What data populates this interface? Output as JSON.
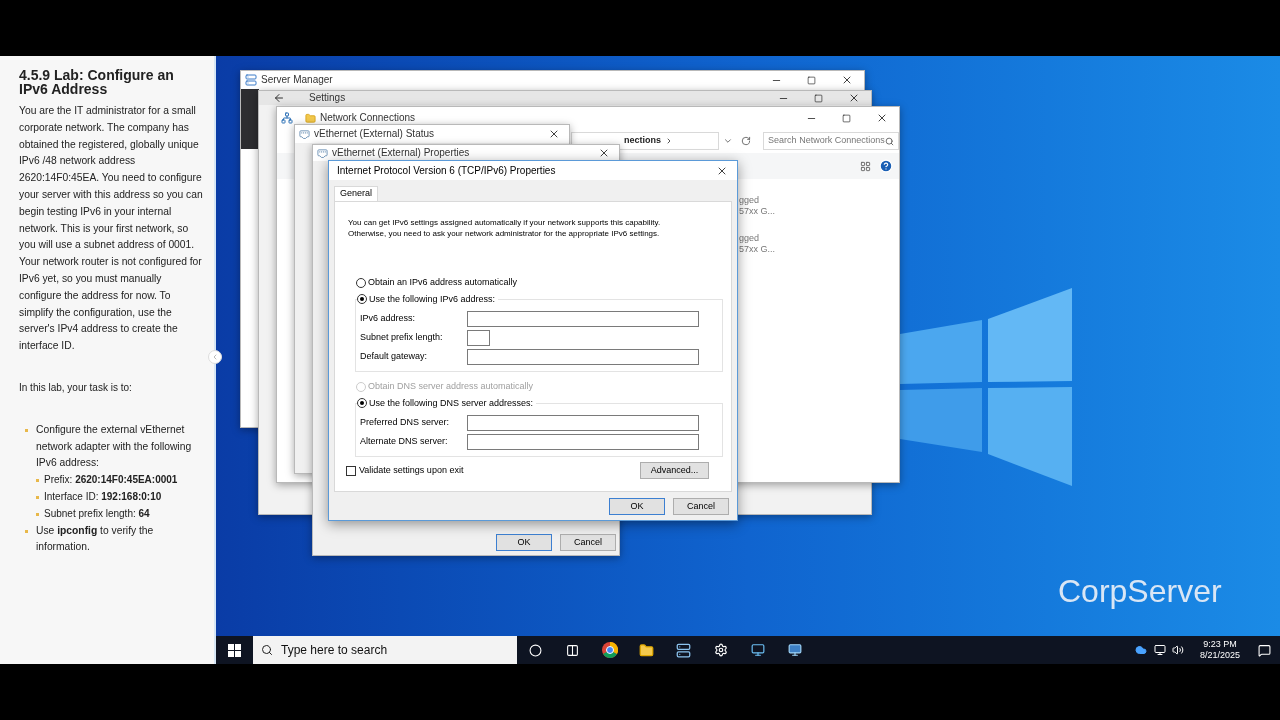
{
  "lesson": {
    "title": "4.5.9 Lab: Configure an IPv6 Address",
    "paragraph": "You are the IT administrator for a small corporate network. The company has obtained the registered, globally unique IPv6 /48 network address 2620:14F0:45EA. You need to configure your server with this address so you can begin testing IPv6 in your internal network. This is your first network, so you will use a subnet address of 0001. Your network router is not configured for IPv6 yet, so you must manually configure the address for now. To simplify the configuration, use the server's IPv4 address to create the interface ID.",
    "task_intro": "In this lab, your task is to:",
    "tasks": [
      {
        "text": "Configure the external vEthernet network adapter with the following IPv6 address:",
        "children": [
          {
            "text": "Prefix: **2620:14F0:45EA:0001**"
          },
          {
            "text": "Interface ID: **192:168:0:10**"
          },
          {
            "text": "Subnet prefix length: **64**"
          }
        ]
      },
      {
        "text": "Use **ipconfig** to verify the information."
      }
    ]
  },
  "windows": [
    {
      "kind": "server-manager",
      "title": "Server Manager",
      "minimizable": true
    },
    {
      "kind": "settings",
      "title": "Settings",
      "minimizable": true
    },
    {
      "kind": "network-connections",
      "title": "Network Connections",
      "minimizable": true,
      "address": "nections",
      "search": {
        "placeholder": "Search Network Connections"
      },
      "items": [
        {
          "status": "gged",
          "device": "57xx G..."
        },
        {
          "status": "gged",
          "device": "57xx G..."
        }
      ]
    },
    {
      "kind": "status",
      "title": "vEthernet (External) Status",
      "minimizable": false
    },
    {
      "kind": "properties",
      "title": "vEthernet (External) Properties",
      "minimizable": false,
      "buttons": [
        {
          "label": "OK",
          "default": true
        },
        {
          "label": "Cancel",
          "default": false
        }
      ]
    }
  ],
  "dialog": {
    "title": "Internet Protocol Version 6 (TCP/IPv6) Properties",
    "tabs": [
      {
        "label": "General",
        "selected": true
      }
    ],
    "intro": [
      "You can get IPv6 settings assigned automatically if your network supports this capability.",
      "Otherwise, you need to ask your network administrator for the appropriate IPv6 settings."
    ],
    "address_options": [
      {
        "label": "Obtain an IPv6 address automatically",
        "selected": false,
        "disabled": false
      },
      {
        "label": "Use the following IPv6 address:",
        "selected": true,
        "disabled": false
      }
    ],
    "address_fields": [
      {
        "label": "IPv6 address:",
        "kind": "wide"
      },
      {
        "label": "Subnet prefix length:",
        "kind": "short"
      },
      {
        "label": "Default gateway:",
        "kind": "wide"
      }
    ],
    "dns_options": [
      {
        "label": "Obtain DNS server address automatically",
        "selected": false,
        "disabled": true
      },
      {
        "label": "Use the following DNS server addresses:",
        "selected": true,
        "disabled": false
      }
    ],
    "dns_fields": [
      {
        "label": "Preferred DNS server:",
        "kind": "wide"
      },
      {
        "label": "Alternate DNS server:",
        "kind": "wide"
      }
    ],
    "validate": {
      "label": "Validate settings upon exit",
      "checked": false
    },
    "advanced": "Advanced...",
    "buttons": [
      {
        "label": "OK",
        "default": true
      },
      {
        "label": "Cancel",
        "default": false
      }
    ]
  },
  "desktop": {
    "label": "CorpServer"
  },
  "taskbar": {
    "search": {
      "placeholder": "Type here to search"
    },
    "time": "9:23 PM",
    "date": "8/21/2025"
  }
}
